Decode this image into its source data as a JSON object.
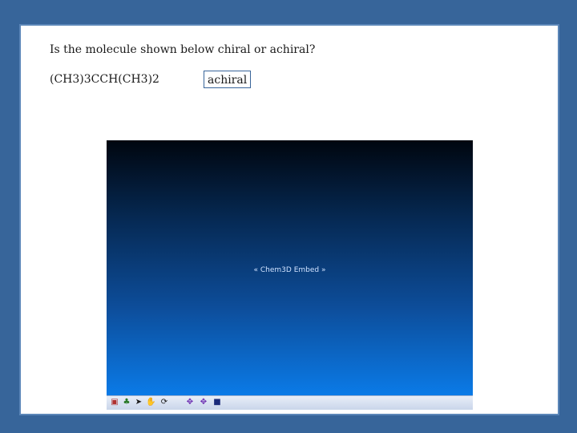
{
  "question": {
    "text": "Is the molecule shown below chiral or achiral?"
  },
  "formula": {
    "text": "(CH3)3CCH(CH3)2"
  },
  "answer": {
    "value": "achiral"
  },
  "embed": {
    "label": "« Chem3D Embed »",
    "toolbar": [
      {
        "icon": "document-icon",
        "glyph": "▣",
        "color": "#b03030"
      },
      {
        "icon": "atom-tool-icon",
        "glyph": "♣",
        "color": "#2a7a2a"
      },
      {
        "icon": "select-arrow-icon",
        "glyph": "➤",
        "color": "#1b1b1b"
      },
      {
        "icon": "hand-pan-icon",
        "glyph": "✋",
        "color": "#1b1b1b"
      },
      {
        "icon": "rotate-icon",
        "glyph": "⟳",
        "color": "#1b1b1b"
      },
      {
        "icon": "move-x-icon",
        "glyph": "✥",
        "color": "#6a2ab0"
      },
      {
        "icon": "move-y-icon",
        "glyph": "✥",
        "color": "#6a2ab0"
      },
      {
        "icon": "stop-square-icon",
        "glyph": "■",
        "color": "#1a2a7a"
      }
    ]
  }
}
